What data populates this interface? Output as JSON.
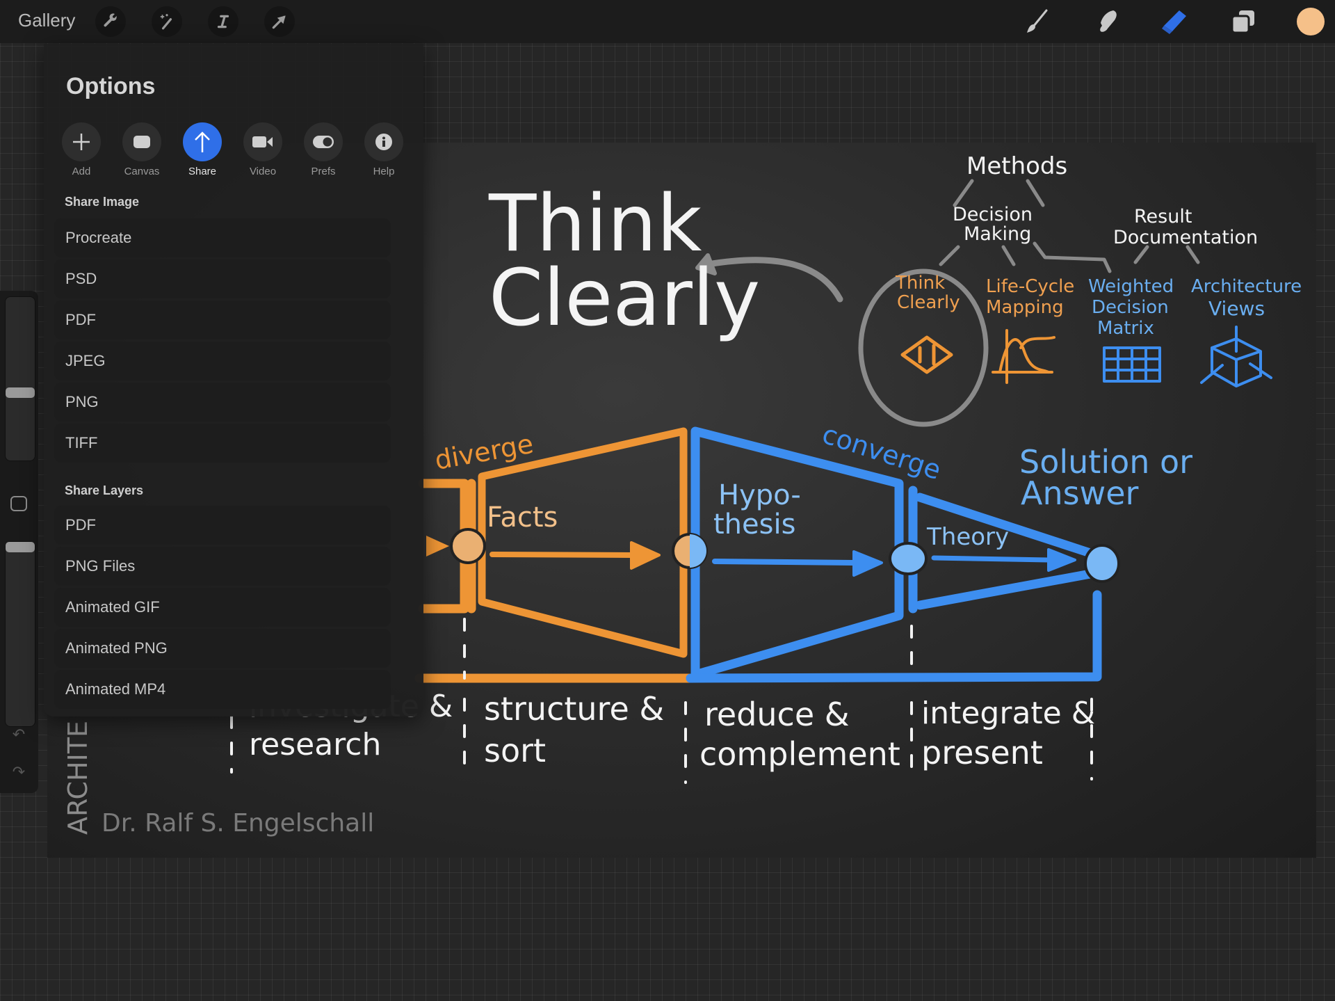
{
  "topbar": {
    "gallery_label": "Gallery",
    "left_tools": [
      {
        "name": "actions",
        "icon": "wrench-icon"
      },
      {
        "name": "adjustments",
        "icon": "magic-wand-icon"
      },
      {
        "name": "selection",
        "icon": "selection-s-icon"
      },
      {
        "name": "transform",
        "icon": "arrow-cursor-icon"
      }
    ],
    "right_tools": [
      {
        "name": "brush",
        "icon": "brush-icon",
        "active": false
      },
      {
        "name": "smudge",
        "icon": "smudge-finger-icon",
        "active": false
      },
      {
        "name": "eraser",
        "icon": "eraser-icon",
        "active": true
      },
      {
        "name": "layers",
        "icon": "layers-icon",
        "active": false
      }
    ],
    "current_color": "#f5c089",
    "accent_color": "#2f6fe8"
  },
  "options_panel": {
    "title": "Options",
    "tabs": [
      {
        "label": "Add",
        "icon": "plus-icon",
        "active": false
      },
      {
        "label": "Canvas",
        "icon": "canvas-icon",
        "active": false
      },
      {
        "label": "Share",
        "icon": "share-arrow-icon",
        "active": true
      },
      {
        "label": "Video",
        "icon": "video-camera-icon",
        "active": false
      },
      {
        "label": "Prefs",
        "icon": "toggle-icon",
        "active": false
      },
      {
        "label": "Help",
        "icon": "info-icon",
        "active": false
      }
    ],
    "share_image": {
      "heading": "Share Image",
      "items": [
        "Procreate",
        "PSD",
        "PDF",
        "JPEG",
        "PNG",
        "TIFF"
      ]
    },
    "share_layers": {
      "heading": "Share Layers",
      "items": [
        "PDF",
        "PNG Files",
        "Animated GIF",
        "Animated PNG",
        "Animated MP4"
      ]
    }
  },
  "sidebar": {
    "brush_size_fraction": 0.6,
    "opacity_fraction": 1.0,
    "undo_icon": "undo-icon",
    "redo_icon": "redo-icon"
  },
  "artwork": {
    "title_line1": "Think",
    "title_line2": "Clearly",
    "methods": "Methods",
    "decision_making": [
      "Decision",
      "Making"
    ],
    "result_documentation": [
      "Result",
      "Documentation"
    ],
    "method_items": [
      {
        "lines": [
          "Think",
          "Clearly"
        ],
        "color": "#f0a050"
      },
      {
        "lines": [
          "Life-Cycle",
          "Mapping"
        ],
        "color": "#f0a050"
      },
      {
        "lines": [
          "Weighted",
          "Decision",
          "Matrix"
        ],
        "color": "#6aaef0"
      },
      {
        "lines": [
          "Architecture",
          "Views"
        ],
        "color": "#6aaef0"
      }
    ],
    "diverge": "diverge",
    "converge": "converge",
    "facts": "Facts",
    "hypothesis": [
      "Hypo-",
      "thesis"
    ],
    "theory": "Theory",
    "solution": [
      "Solution or",
      "Answer"
    ],
    "phases": [
      {
        "lines": [
          "investigate &",
          "research"
        ]
      },
      {
        "lines": [
          "structure &",
          "sort"
        ]
      },
      {
        "lines": [
          "reduce &",
          "complement"
        ]
      },
      {
        "lines": [
          "integrate &",
          "present"
        ]
      }
    ],
    "vertical_text": "ARCHITE",
    "author": "Dr. Ralf S. Engelschall",
    "orange": "#ee9535",
    "blue": "#3d8ef0"
  }
}
